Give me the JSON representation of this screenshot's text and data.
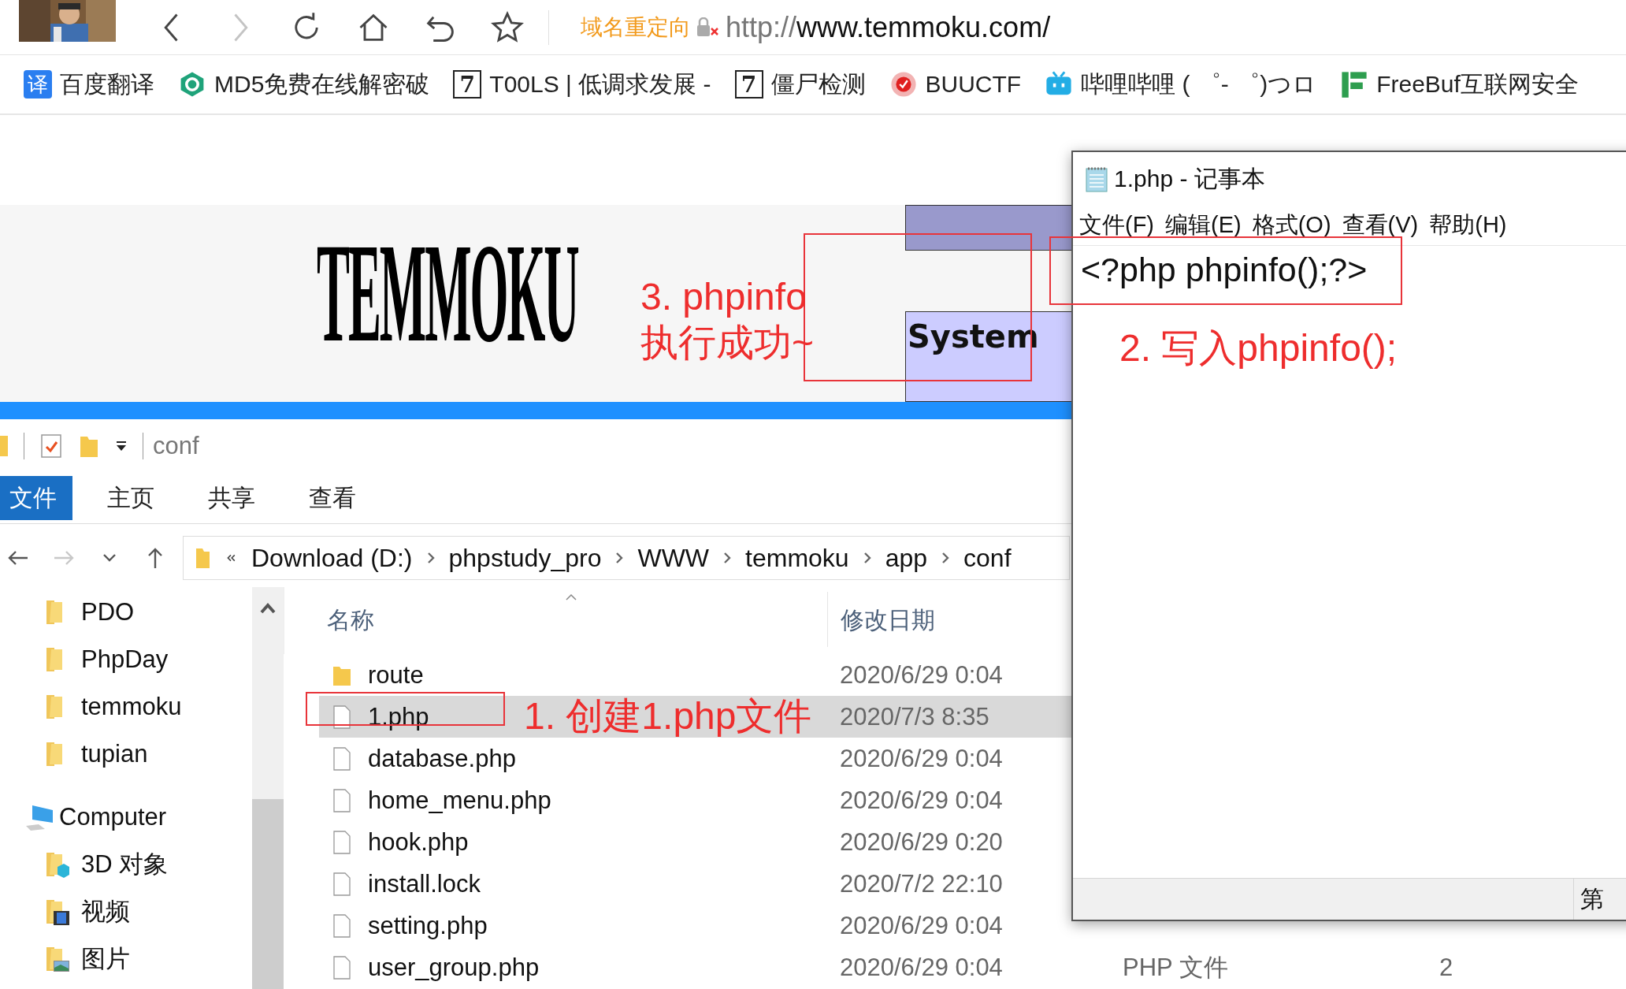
{
  "browser": {
    "nav_buttons": [
      {
        "kind": "back",
        "disabled": false
      },
      {
        "kind": "forward",
        "disabled": true
      },
      {
        "kind": "reload",
        "disabled": false
      },
      {
        "kind": "home",
        "disabled": false
      },
      {
        "kind": "undo",
        "disabled": false
      },
      {
        "kind": "star",
        "disabled": false
      }
    ],
    "redirect_label": "域名重定向",
    "url_scheme": "http://",
    "url_host": "www.temmoku.com/"
  },
  "bookmarks": [
    {
      "kind": "badge",
      "icon_text": "译",
      "label": "百度翻译"
    },
    {
      "kind": "shield",
      "label": "MD5免费在线解密破"
    },
    {
      "kind": "tile",
      "icon_text": "7",
      "label": "T00LS | 低调求发展 -"
    },
    {
      "kind": "tile",
      "icon_text": "7",
      "label": "僵尸检测"
    },
    {
      "kind": "seal",
      "label": "BUUCTF"
    },
    {
      "kind": "tv",
      "label": "哔哩哔哩 ( ゜- ゜)つロ"
    },
    {
      "kind": "bars",
      "label": "FreeBuf互联网安全"
    }
  ],
  "web_page": {
    "logo": "TEMMOKU",
    "system_label": "System"
  },
  "explorer": {
    "title": "conf",
    "ribbon_tabs": [
      {
        "label": "文件",
        "selected": true
      },
      {
        "label": "主页",
        "selected": false
      },
      {
        "label": "共享",
        "selected": false
      },
      {
        "label": "查看",
        "selected": false
      }
    ],
    "nav_buttons": [
      {
        "kind": "back",
        "disabled": false
      },
      {
        "kind": "forward",
        "disabled": true
      },
      {
        "kind": "recent",
        "disabled": false
      },
      {
        "kind": "up",
        "disabled": false
      }
    ],
    "breadcrumb": [
      "Download (D:)",
      "phpstudy_pro",
      "WWW",
      "temmoku",
      "app",
      "conf"
    ],
    "nav_pane": [
      {
        "kind": "folder",
        "label": "PDO"
      },
      {
        "kind": "folder",
        "label": "PhpDay"
      },
      {
        "kind": "folder",
        "label": "temmoku"
      },
      {
        "kind": "folder",
        "label": "tupian"
      },
      {
        "kind": "computer",
        "label": "Computer"
      },
      {
        "kind": "objects",
        "label": "3D 对象"
      },
      {
        "kind": "video",
        "label": "视频"
      },
      {
        "kind": "pictures",
        "label": "图片"
      }
    ],
    "columns": [
      "名称",
      "修改日期"
    ],
    "files": [
      {
        "kind": "folder",
        "name": "route",
        "modified": "2020/6/29 0:04",
        "selected": false
      },
      {
        "kind": "file",
        "name": "1.php",
        "modified": "2020/7/3 8:35",
        "selected": true
      },
      {
        "kind": "file",
        "name": "database.php",
        "modified": "2020/6/29 0:04",
        "selected": false
      },
      {
        "kind": "file",
        "name": "home_menu.php",
        "modified": "2020/6/29 0:04",
        "selected": false
      },
      {
        "kind": "file",
        "name": "hook.php",
        "modified": "2020/6/29 0:20",
        "selected": false
      },
      {
        "kind": "file",
        "name": "install.lock",
        "modified": "2020/7/2 22:10",
        "selected": false
      },
      {
        "kind": "file",
        "name": "setting.php",
        "modified": "2020/6/29 0:04",
        "selected": false
      },
      {
        "kind": "file",
        "name": "user_group.php",
        "modified": "2020/6/29 0:04",
        "type": "PHP 文件",
        "size": "2",
        "selected": false
      }
    ]
  },
  "notepad": {
    "title": "1.php - 记事本",
    "menu": [
      "文件(F)",
      "编辑(E)",
      "格式(O)",
      "查看(V)",
      "帮助(H)"
    ],
    "content": "<?php phpinfo();?>",
    "status_text": "第"
  },
  "annotations": [
    "3. phpinfo\n执行成功~",
    "2. 写入phpinfo();",
    "1. 创建1.php文件"
  ]
}
